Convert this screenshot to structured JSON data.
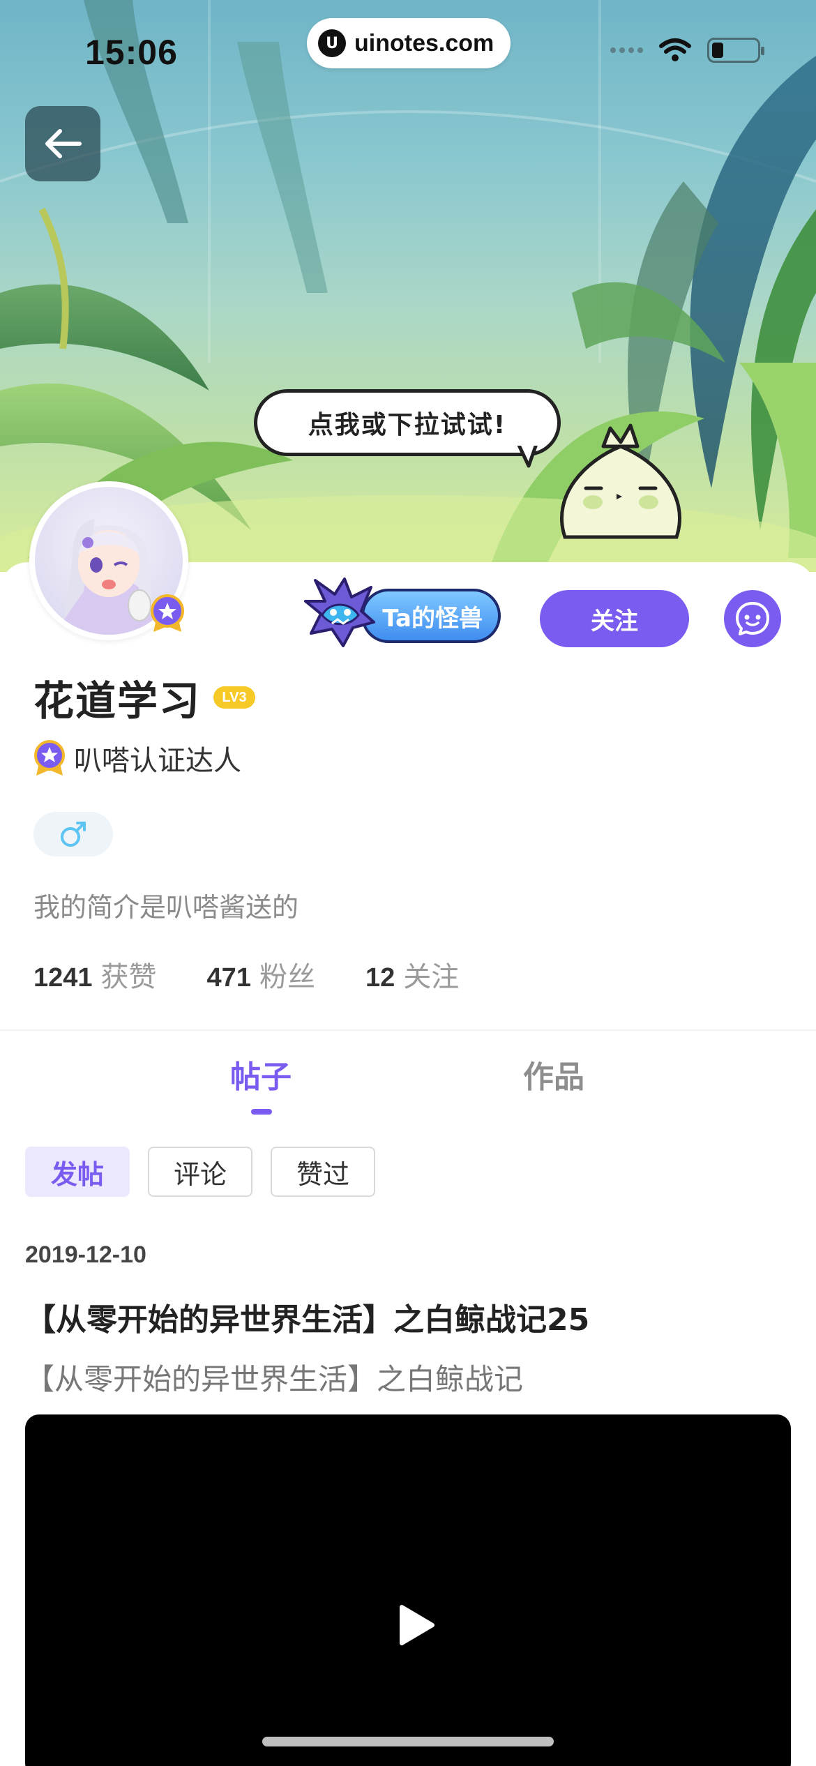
{
  "status_bar": {
    "time": "15:06",
    "url": "uinotes.com",
    "icons": [
      "cellular-icon",
      "wifi-icon",
      "battery-icon"
    ]
  },
  "banner": {
    "bubble_text": "点我或下拉试试!",
    "back_icon": "arrow-left-icon"
  },
  "profile": {
    "name": "花道学习",
    "level": "LV3",
    "certification": "叭嗒认证达人",
    "gender": "♂",
    "bio": "我的简介是叭嗒酱送的",
    "monster_button": "Ta的怪兽",
    "follow_button": "关注",
    "chat_icon": "chat-bubble-icon",
    "stats": [
      {
        "num": "1241",
        "label": "获赞"
      },
      {
        "num": "471",
        "label": "粉丝"
      },
      {
        "num": "12",
        "label": "关注"
      }
    ]
  },
  "tabs": [
    {
      "label": "帖子",
      "active": true
    },
    {
      "label": "作品",
      "active": false
    }
  ],
  "filters": [
    {
      "label": "发帖",
      "active": true
    },
    {
      "label": "评论",
      "active": false
    },
    {
      "label": "赞过",
      "active": false
    }
  ],
  "post": {
    "date": "2019-12-10",
    "title": "【从零开始的异世界生活】之白鲸战记25",
    "subtitle": "【从零开始的异世界生活】之白鲸战记",
    "video_icon": "play-icon"
  },
  "colors": {
    "accent": "#7b5cf0",
    "level_badge": "#f7c927"
  }
}
